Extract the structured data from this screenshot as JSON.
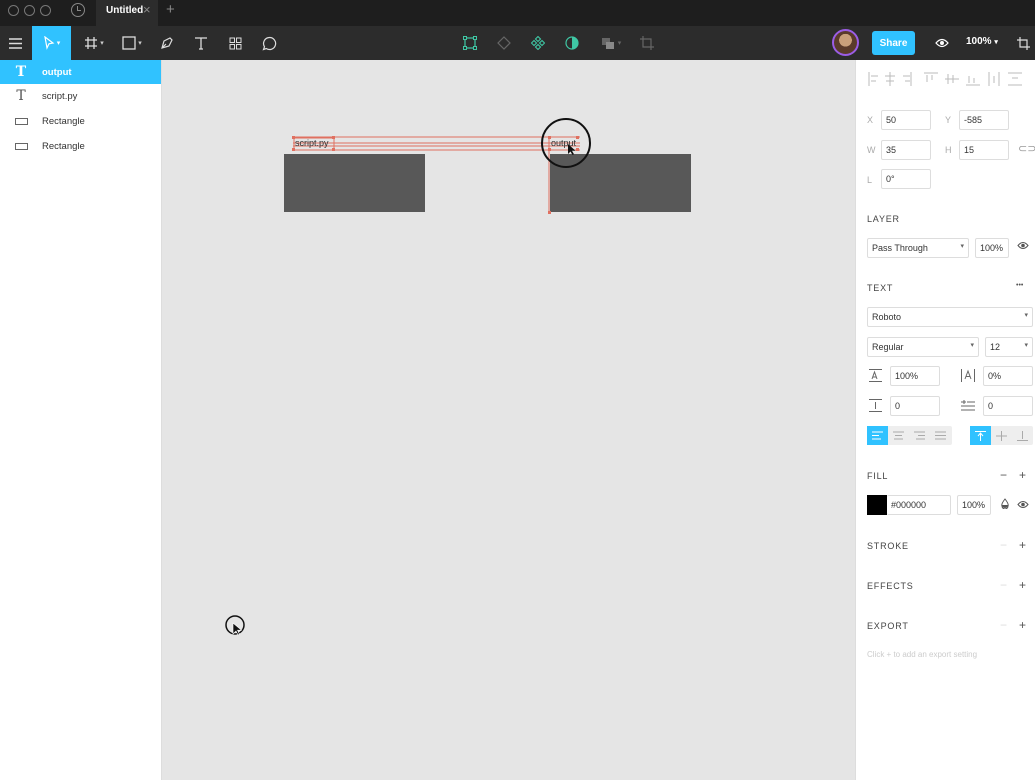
{
  "titlebar": {
    "doc_tab": "Untitled",
    "close_glyph": "×",
    "new_tab_glyph": "+"
  },
  "toolbar": {
    "tools_left": [
      "menu-icon",
      "move-tool-icon",
      "frame-tool-icon",
      "rectangle-tool-icon",
      "pen-tool-icon",
      "text-tool-icon",
      "components-icon",
      "comment-icon"
    ],
    "tools_center": [
      "edit-object-icon",
      "bool-icon",
      "component-icon",
      "mask-icon",
      "group-icon",
      "crop-icon"
    ],
    "share_label": "Share",
    "zoom_label": "100%",
    "accent": "#30c2ff"
  },
  "layers": {
    "items": [
      {
        "label": "output",
        "type": "text",
        "selected": true
      },
      {
        "label": "script.py",
        "type": "text",
        "selected": false
      },
      {
        "label": "Rectangle",
        "type": "rectangle",
        "selected": false
      },
      {
        "label": "Rectangle",
        "type": "rectangle",
        "selected": false
      }
    ]
  },
  "canvas": {
    "label_script": "script.py",
    "label_output": "output",
    "rect_color": "#585858",
    "guide_color": "#e07060"
  },
  "props": {
    "x_label": "X",
    "x_value": "50",
    "y_label": "Y",
    "y_value": "-585",
    "w_label": "W",
    "w_value": "35",
    "h_label": "H",
    "h_value": "15",
    "rot_label": "L",
    "rot_value": "0°",
    "layer_title": "LAYER",
    "blend_mode": "Pass Through",
    "layer_opacity": "100%",
    "text_title": "TEXT",
    "more_glyph": "•••",
    "font_family": "Roboto",
    "font_style": "Regular",
    "font_size": "12",
    "line_height": "100%",
    "letter_spacing": "0%",
    "para_spacing": "0",
    "para_indent": "0",
    "fill_title": "FILL",
    "fill_hex": "#000000",
    "fill_opacity": "100%",
    "fill_color": "#000000",
    "stroke_title": "STROKE",
    "effects_title": "EFFECTS",
    "export_title": "EXPORT",
    "export_hint": "Click + to add an export setting",
    "minus_glyph": "−",
    "plus_glyph": "+"
  }
}
